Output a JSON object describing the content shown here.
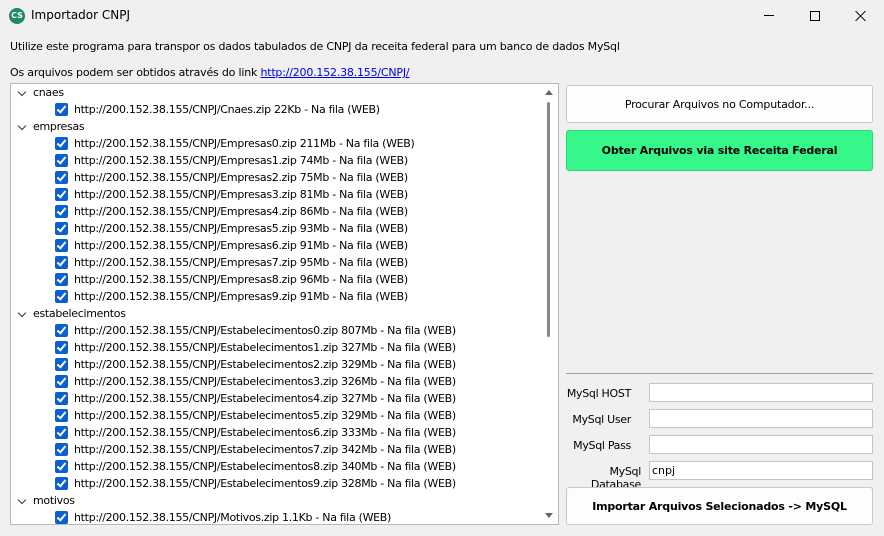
{
  "window": {
    "title": "Importador CNPJ",
    "icon_text": "CS"
  },
  "intro": {
    "line1": "Utilize este programa para transpor os dados tabulados de CNPJ da receita federal para um banco de dados MySql",
    "line2_prefix": "Os arquivos podem ser obtidos através do link ",
    "link_text": "http://200.152.38.155/CNPJ/"
  },
  "tree": [
    {
      "group": "cnaes",
      "items": [
        "http://200.152.38.155/CNPJ/Cnaes.zip 22Kb - Na fila (WEB)"
      ]
    },
    {
      "group": "empresas",
      "items": [
        "http://200.152.38.155/CNPJ/Empresas0.zip 211Mb - Na fila (WEB)",
        "http://200.152.38.155/CNPJ/Empresas1.zip 74Mb - Na fila (WEB)",
        "http://200.152.38.155/CNPJ/Empresas2.zip 75Mb - Na fila (WEB)",
        "http://200.152.38.155/CNPJ/Empresas3.zip 81Mb - Na fila (WEB)",
        "http://200.152.38.155/CNPJ/Empresas4.zip 86Mb - Na fila (WEB)",
        "http://200.152.38.155/CNPJ/Empresas5.zip 93Mb - Na fila (WEB)",
        "http://200.152.38.155/CNPJ/Empresas6.zip 91Mb - Na fila (WEB)",
        "http://200.152.38.155/CNPJ/Empresas7.zip 95Mb - Na fila (WEB)",
        "http://200.152.38.155/CNPJ/Empresas8.zip 96Mb - Na fila (WEB)",
        "http://200.152.38.155/CNPJ/Empresas9.zip 91Mb - Na fila (WEB)"
      ]
    },
    {
      "group": "estabelecimentos",
      "items": [
        "http://200.152.38.155/CNPJ/Estabelecimentos0.zip 807Mb - Na fila (WEB)",
        "http://200.152.38.155/CNPJ/Estabelecimentos1.zip 327Mb - Na fila (WEB)",
        "http://200.152.38.155/CNPJ/Estabelecimentos2.zip 329Mb - Na fila (WEB)",
        "http://200.152.38.155/CNPJ/Estabelecimentos3.zip 326Mb - Na fila (WEB)",
        "http://200.152.38.155/CNPJ/Estabelecimentos4.zip 327Mb - Na fila (WEB)",
        "http://200.152.38.155/CNPJ/Estabelecimentos5.zip 329Mb - Na fila (WEB)",
        "http://200.152.38.155/CNPJ/Estabelecimentos6.zip 333Mb - Na fila (WEB)",
        "http://200.152.38.155/CNPJ/Estabelecimentos7.zip 342Mb - Na fila (WEB)",
        "http://200.152.38.155/CNPJ/Estabelecimentos8.zip 340Mb - Na fila (WEB)",
        "http://200.152.38.155/CNPJ/Estabelecimentos9.zip 328Mb - Na fila (WEB)"
      ]
    },
    {
      "group": "motivos",
      "items": [
        "http://200.152.38.155/CNPJ/Motivos.zip 1.1Kb - Na fila (WEB)"
      ]
    }
  ],
  "buttons": {
    "browse": "Procurar Arquivos no Computador...",
    "download": "Obter Arquivos via site Receita Federal",
    "import": "Importar Arquivos Selecionados -> MySQL"
  },
  "mysql": {
    "host_label": "MySql HOST",
    "host_value": "",
    "user_label": "MySql User",
    "user_value": "",
    "pass_label": "MySql Pass",
    "pass_value": "",
    "db_label": "MySql Database",
    "db_value": "cnpj"
  },
  "colors": {
    "accent_checkbox": "#0b5fd1",
    "download_button": "#36f78a",
    "link": "#0000ee"
  }
}
